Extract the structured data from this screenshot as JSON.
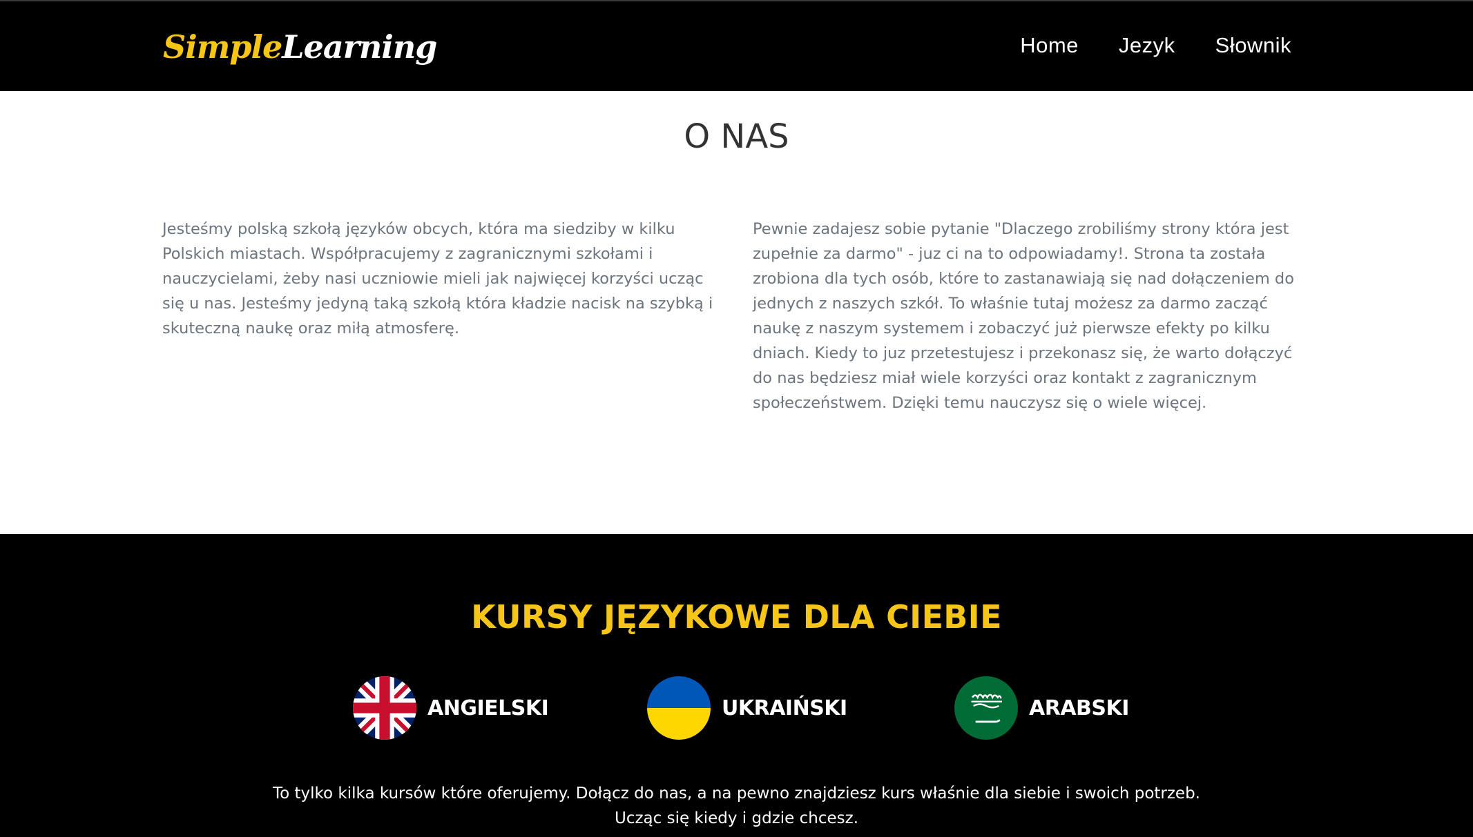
{
  "navbar": {
    "brand_part1": "Simple",
    "brand_part2": "Learning",
    "links": [
      {
        "label": "Home"
      },
      {
        "label": "Jezyk"
      },
      {
        "label": "Słownik"
      }
    ]
  },
  "about": {
    "title": "O NAS",
    "left_text": "Jesteśmy polską szkołą języków obcych, która ma siedziby w kilku Polskich miastach. Współpracujemy z zagranicznymi szkołami i nauczycielami, żeby nasi uczniowie mieli jak najwięcej korzyści ucząc się u nas. Jesteśmy jedyną taką szkołą która kładzie nacisk na szybką i skuteczną naukę oraz miłą atmosferę.",
    "right_text": "Pewnie zadajesz sobie pytanie \"Dlaczego zrobiliśmy strony która jest zupełnie za darmo\" - juz ci na to odpowiadamy!. Strona ta została zrobiona dla tych osób, które to zastanawiają się nad dołączeniem do jednych z naszych szkół. To właśnie tutaj możesz za darmo zacząć naukę z naszym systemem i zobaczyć już pierwsze efekty po kilku dniach. Kiedy to juz przetestujesz i przekonasz się, że warto dołączyć do nas będziesz miał wiele korzyści oraz kontakt z zagranicznym społeczeństwem. Dzięki temu nauczysz się o wiele więcej."
  },
  "courses": {
    "title": "KURSY JĘZYKOWE DLA CIEBIE",
    "items": [
      {
        "label": "ANGIELSKI",
        "flag": "uk-flag-icon"
      },
      {
        "label": "UKRAIŃSKI",
        "flag": "ukraine-flag-icon"
      },
      {
        "label": "ARABSKI",
        "flag": "saudi-arabia-flag-icon"
      }
    ],
    "note_line1": "To tylko kilka kursów które oferujemy. Dołącz do nas, a na pewno znajdziesz kurs właśnie dla siebie i swoich potrzeb.",
    "note_line2": "Ucząc się kiedy i gdzie chcesz."
  },
  "colors": {
    "accent": "#f5c518",
    "dark_bg": "#000000",
    "body_text": "#6c757d",
    "heading": "#333333",
    "uk_blue": "#012169",
    "uk_red": "#C8102E",
    "ua_blue": "#0057B7",
    "ua_yellow": "#FFD700",
    "sa_green": "#006C35"
  }
}
